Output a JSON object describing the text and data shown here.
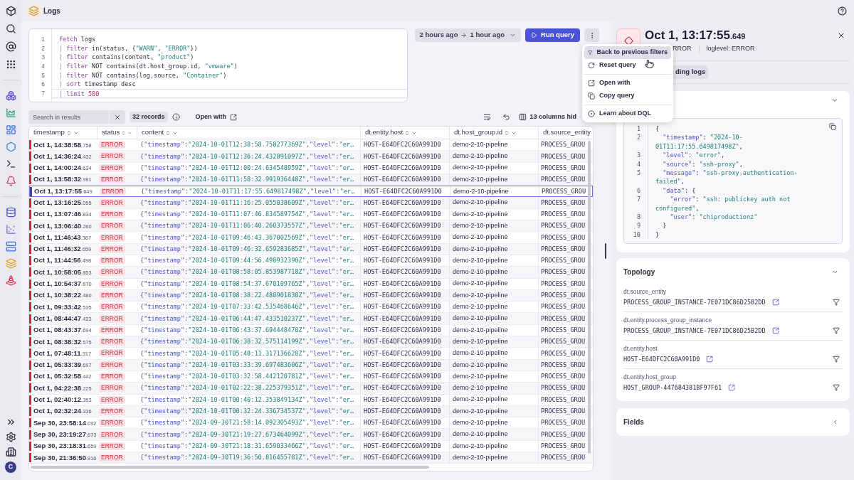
{
  "sidebar": {
    "avatar": "C"
  },
  "header": {
    "title": "Logs"
  },
  "editor": {
    "lines": [
      {
        "n": "1",
        "current": false,
        "segs": [
          {
            "text": "fetch",
            "kind": "kw"
          },
          {
            "text": " logs",
            "kind": "plain"
          }
        ]
      },
      {
        "n": "2",
        "current": false,
        "segs": [
          {
            "text": "| ",
            "kind": "pipe"
          },
          {
            "text": "filter",
            "kind": "kw"
          },
          {
            "text": " in(status, {",
            "kind": "plain"
          },
          {
            "text": "\"WARN\"",
            "kind": "str"
          },
          {
            "text": ", ",
            "kind": "plain"
          },
          {
            "text": "\"ERROR\"",
            "kind": "str"
          },
          {
            "text": "})",
            "kind": "plain"
          }
        ]
      },
      {
        "n": "3",
        "current": false,
        "segs": [
          {
            "text": "| ",
            "kind": "pipe"
          },
          {
            "text": "filter",
            "kind": "kw"
          },
          {
            "text": " contains(content, ",
            "kind": "plain"
          },
          {
            "text": "\"product\"",
            "kind": "str"
          },
          {
            "text": ")",
            "kind": "plain"
          }
        ]
      },
      {
        "n": "4",
        "current": false,
        "segs": [
          {
            "text": "| ",
            "kind": "pipe"
          },
          {
            "text": "filter",
            "kind": "kw"
          },
          {
            "text": " NOT contains(dt.host_group.id, ",
            "kind": "plain"
          },
          {
            "text": "\"vmware\"",
            "kind": "str"
          },
          {
            "text": ")",
            "kind": "plain"
          }
        ]
      },
      {
        "n": "5",
        "current": false,
        "segs": [
          {
            "text": "| ",
            "kind": "pipe"
          },
          {
            "text": "filter",
            "kind": "kw"
          },
          {
            "text": " NOT contains(log.source, ",
            "kind": "plain"
          },
          {
            "text": "\"Container\"",
            "kind": "str"
          },
          {
            "text": ")",
            "kind": "plain"
          }
        ]
      },
      {
        "n": "6",
        "current": false,
        "segs": [
          {
            "text": "| ",
            "kind": "pipe"
          },
          {
            "text": "sort",
            "kind": "kw"
          },
          {
            "text": " timestamp desc",
            "kind": "plain"
          }
        ]
      },
      {
        "n": "7",
        "current": true,
        "segs": [
          {
            "text": "| ",
            "kind": "pipe"
          },
          {
            "text": "limit",
            "kind": "kw"
          },
          {
            "text": " 500",
            "kind": "num"
          }
        ]
      }
    ]
  },
  "timeframe": {
    "from": "2 hours ago",
    "to": "1 hour ago"
  },
  "run_button": "Run query",
  "menu": {
    "groups": [
      [
        {
          "label": "Back to previous filters",
          "highlighted": true
        },
        {
          "label": "Reset query",
          "highlighted": false
        }
      ],
      [
        {
          "label": "Open with",
          "highlighted": false
        },
        {
          "label": "Copy query",
          "highlighted": false
        }
      ],
      [
        {
          "label": "Learn about DQL",
          "highlighted": false
        }
      ]
    ]
  },
  "results_toolbar": {
    "search_placeholder": "Search in results",
    "records": "32 records",
    "open_with": "Open with",
    "columns_hidden": "13 columns hid"
  },
  "table": {
    "columns": [
      "timestamp",
      "status",
      "content",
      "dt.entity.host",
      "dt.host_group.id",
      "dt.source_entity"
    ],
    "rows": [
      {
        "ts": "Oct 1, 14:38:58",
        "ms": ".758",
        "status": "ERROR",
        "content": "{\"timestamp\":\"2024-10-01T12:38:58.758277369Z\",\"level\":\"er…",
        "host": "HOST-E64DFC2C60A991D0",
        "group": "demo-2-10-pipeline",
        "source": "PROCESS_GROU",
        "selected": false
      },
      {
        "ts": "Oct 1, 14:36:24",
        "ms": ".432",
        "status": "ERROR",
        "content": "{\"timestamp\":\"2024-10-01T12:36:24.432891097Z\",\"level\":\"er…",
        "host": "HOST-E64DFC2C60A991D0",
        "group": "demo-2-10-pipeline",
        "source": "PROCESS_GROU",
        "selected": false
      },
      {
        "ts": "Oct 1, 14:00:24",
        "ms": ".634",
        "status": "ERROR",
        "content": "{\"timestamp\":\"2024-10-01T12:00:24.634548959Z\",\"level\":\"er…",
        "host": "HOST-E64DFC2C60A991D0",
        "group": "demo-2-10-pipeline",
        "source": "PROCESS_GROU",
        "selected": false
      },
      {
        "ts": "Oct 1, 13:58:32",
        "ms": ".991",
        "status": "ERROR",
        "content": "{\"timestamp\":\"2024-10-01T11:58:32.991936448Z\",\"level\":\"er…",
        "host": "HOST-E64DFC2C60A991D0",
        "group": "demo-2-10-pipeline",
        "source": "PROCESS_GROU",
        "selected": false
      },
      {
        "ts": "Oct 1, 13:17:55",
        "ms": ".649",
        "status": "ERROR",
        "content": "{\"timestamp\":\"2024-10-01T11:17:55.649817498Z\",\"level\":\"er…",
        "host": "HOST-E64DFC2C60A991D0",
        "group": "demo-2-10-pipeline",
        "source": "PROCESS_GROU",
        "selected": true
      },
      {
        "ts": "Oct 1, 13:16:25",
        "ms": ".055",
        "status": "ERROR",
        "content": "{\"timestamp\":\"2024-10-01T11:16:25.055038609Z\",\"level\":\"er…",
        "host": "HOST-E64DFC2C60A991D0",
        "group": "demo-2-10-pipeline",
        "source": "PROCESS_GROU",
        "selected": false
      },
      {
        "ts": "Oct 1, 13:07:46",
        "ms": ".834",
        "status": "ERROR",
        "content": "{\"timestamp\":\"2024-10-01T11:07:46.834589754Z\",\"level\":\"er…",
        "host": "HOST-E64DFC2C60A991D0",
        "group": "demo-2-10-pipeline",
        "source": "PROCESS_GROU",
        "selected": false
      },
      {
        "ts": "Oct 1, 13:06:40",
        "ms": ".260",
        "status": "ERROR",
        "content": "{\"timestamp\":\"2024-10-01T11:06:40.260373557Z\",\"level\":\"er…",
        "host": "HOST-E64DFC2C60A991D0",
        "group": "demo-2-10-pipeline",
        "source": "PROCESS_GROU",
        "selected": false
      },
      {
        "ts": "Oct 1, 11:46:43",
        "ms": ".367",
        "status": "ERROR",
        "content": "{\"timestamp\":\"2024-10-01T09:46:43.367002569Z\",\"level\":\"er…",
        "host": "HOST-E64DFC2C60A991D0",
        "group": "demo-2-10-pipeline",
        "source": "PROCESS_GROU",
        "selected": false
      },
      {
        "ts": "Oct 1, 11:46:32",
        "ms": ".659",
        "status": "ERROR",
        "content": "{\"timestamp\":\"2024-10-01T09:46:32.659283685Z\",\"level\":\"er…",
        "host": "HOST-E64DFC2C60A991D0",
        "group": "demo-2-10-pipeline",
        "source": "PROCESS_GROU",
        "selected": false
      },
      {
        "ts": "Oct 1, 11:44:56",
        "ms": ".498",
        "status": "ERROR",
        "content": "{\"timestamp\":\"2024-10-01T09:44:56.498932390Z\",\"level\":\"er…",
        "host": "HOST-E64DFC2C60A991D0",
        "group": "demo-2-10-pipeline",
        "source": "PROCESS_GROU",
        "selected": false
      },
      {
        "ts": "Oct 1, 10:58:05",
        "ms": ".853",
        "status": "ERROR",
        "content": "{\"timestamp\":\"2024-10-01T08:58:05.853987718Z\",\"level\":\"er…",
        "host": "HOST-E64DFC2C60A991D0",
        "group": "demo-2-10-pipeline",
        "source": "PROCESS_GROU",
        "selected": false
      },
      {
        "ts": "Oct 1, 10:54:37",
        "ms": ".670",
        "status": "ERROR",
        "content": "{\"timestamp\":\"2024-10-01T08:54:37.670109765Z\",\"level\":\"er…",
        "host": "HOST-E64DFC2C60A991D0",
        "group": "demo-2-10-pipeline",
        "source": "PROCESS_GROU",
        "selected": false
      },
      {
        "ts": "Oct 1, 10:38:22",
        "ms": ".480",
        "status": "ERROR",
        "content": "{\"timestamp\":\"2024-10-01T08:38:22.480901830Z\",\"level\":\"er…",
        "host": "HOST-E64DFC2C60A991D0",
        "group": "demo-2-10-pipeline",
        "source": "PROCESS_GROU",
        "selected": false
      },
      {
        "ts": "Oct 1, 09:33:42",
        "ms": ".535",
        "status": "ERROR",
        "content": "{\"timestamp\":\"2024-10-01T07:33:42.535468646Z\",\"level\":\"er…",
        "host": "HOST-E64DFC2C60A991D0",
        "group": "demo-2-10-pipeline",
        "source": "PROCESS_GROU",
        "selected": false
      },
      {
        "ts": "Oct 1, 08:44:47",
        "ms": ".433",
        "status": "ERROR",
        "content": "{\"timestamp\":\"2024-10-01T06:44:47.433510237Z\",\"level\":\"er…",
        "host": "HOST-E64DFC2C60A991D0",
        "group": "demo-2-10-pipeline",
        "source": "PROCESS_GROU",
        "selected": false
      },
      {
        "ts": "Oct 1, 08:43:37",
        "ms": ".694",
        "status": "ERROR",
        "content": "{\"timestamp\":\"2024-10-01T06:43:37.694448470Z\",\"level\":\"er…",
        "host": "HOST-E64DFC2C60A991D0",
        "group": "demo-2-10-pipeline",
        "source": "PROCESS_GROU",
        "selected": false
      },
      {
        "ts": "Oct 1, 08:38:32",
        "ms": ".575",
        "status": "ERROR",
        "content": "{\"timestamp\":\"2024-10-01T06:38:32.575114199Z\",\"level\":\"er…",
        "host": "HOST-E64DFC2C60A991D0",
        "group": "demo-2-10-pipeline",
        "source": "PROCESS_GROU",
        "selected": false
      },
      {
        "ts": "Oct 1, 07:48:11",
        "ms": ".317",
        "status": "ERROR",
        "content": "{\"timestamp\":\"2024-10-01T05:48:11.317136628Z\",\"level\":\"er…",
        "host": "HOST-E64DFC2C60A991D0",
        "group": "demo-2-10-pipeline",
        "source": "PROCESS_GROU",
        "selected": false
      },
      {
        "ts": "Oct 1, 05:33:39",
        "ms": ".697",
        "status": "ERROR",
        "content": "{\"timestamp\":\"2024-10-01T03:33:39.697483606Z\",\"level\":\"er…",
        "host": "HOST-E64DFC2C60A991D0",
        "group": "demo-2-10-pipeline",
        "source": "PROCESS_GROU",
        "selected": false
      },
      {
        "ts": "Oct 1, 05:32:58",
        "ms": ".442",
        "status": "ERROR",
        "content": "{\"timestamp\":\"2024-10-01T03:32:58.442120781Z\",\"level\":\"er…",
        "host": "HOST-E64DFC2C60A991D0",
        "group": "demo-2-10-pipeline",
        "source": "PROCESS_GROU",
        "selected": false
      },
      {
        "ts": "Oct 1, 04:22:38",
        "ms": ".225",
        "status": "ERROR",
        "content": "{\"timestamp\":\"2024-10-01T02:22:38.225379351Z\",\"level\":\"er…",
        "host": "HOST-E64DFC2C60A991D0",
        "group": "demo-2-10-pipeline",
        "source": "PROCESS_GROU",
        "selected": false
      },
      {
        "ts": "Oct 1, 02:40:12",
        "ms": ".353",
        "status": "ERROR",
        "content": "{\"timestamp\":\"2024-10-01T00:40:12.353849134Z\",\"level\":\"er…",
        "host": "HOST-E64DFC2C60A991D0",
        "group": "demo-2-10-pipeline",
        "source": "PROCESS_GROU",
        "selected": false
      },
      {
        "ts": "Oct 1, 02:32:24",
        "ms": ".336",
        "status": "ERROR",
        "content": "{\"timestamp\":\"2024-10-01T00:32:24.336734537Z\",\"level\":\"er…",
        "host": "HOST-E64DFC2C60A991D0",
        "group": "demo-2-10-pipeline",
        "source": "PROCESS_GROU",
        "selected": false
      },
      {
        "ts": "Sep 30, 23:58:14",
        "ms": ".092",
        "status": "ERROR",
        "content": "{\"timestamp\":\"2024-09-30T21:58:14.092305493Z\",\"level\":\"er…",
        "host": "HOST-E64DFC2C60A991D0",
        "group": "demo-2-10-pipeline",
        "source": "PROCESS_GROU",
        "selected": false
      },
      {
        "ts": "Sep 30, 23:19:27",
        "ms": ".673",
        "status": "ERROR",
        "content": "{\"timestamp\":\"2024-09-30T21:19:27.673464099Z\",\"level\":\"er…",
        "host": "HOST-E64DFC2C60A991D0",
        "group": "demo-2-10-pipeline",
        "source": "PROCESS_GROU",
        "selected": false
      },
      {
        "ts": "Sep 30, 23:18:31",
        "ms": ".659",
        "status": "ERROR",
        "content": "{\"timestamp\":\"2024-09-30T21:18:31.659033466Z\",\"level\":\"er…",
        "host": "HOST-E64DFC2C60A991D0",
        "group": "demo-2-10-pipeline",
        "source": "PROCESS_GROU",
        "selected": false
      },
      {
        "ts": "Sep 30, 21:36:50",
        "ms": ".816",
        "status": "ERROR",
        "content": "{\"timestamp\":\"2024-09-30T19:36:50.816455781Z\",\"level\":\"er…",
        "host": "HOST-E64DFC2C60A991D0",
        "group": "demo-2-10-pipeline",
        "source": "PROCESS_GROU",
        "selected": false
      }
    ]
  },
  "detail": {
    "title": "Oct 1, 13:17:55",
    "title_ms": ".649",
    "status": "RROR",
    "loglevel": "loglevel: ERROR",
    "surrounding_button": "ding logs",
    "expanded": true,
    "code_lines": [
      {
        "n": "1",
        "segs": [
          {
            "text": "{",
            "kind": "plain"
          }
        ]
      },
      {
        "n": "2",
        "segs": [
          {
            "text": "  \"timestamp\"",
            "kind": "key"
          },
          {
            "text": ": ",
            "kind": "plain"
          },
          {
            "text": "\"2024-10-",
            "kind": "str"
          }
        ]
      },
      {
        "segs": [
          {
            "text": "01T11:17:55.649817498Z\"",
            "kind": "str"
          },
          {
            "text": ",",
            "kind": "plain"
          }
        ]
      },
      {
        "n": "3",
        "segs": [
          {
            "text": "  \"level\"",
            "kind": "key"
          },
          {
            "text": ": ",
            "kind": "plain"
          },
          {
            "text": "\"error\"",
            "kind": "str"
          },
          {
            "text": ",",
            "kind": "plain"
          }
        ]
      },
      {
        "n": "4",
        "segs": [
          {
            "text": "  \"source\"",
            "kind": "key"
          },
          {
            "text": ": ",
            "kind": "plain"
          },
          {
            "text": "\"ssh-proxy\"",
            "kind": "str"
          },
          {
            "text": ",",
            "kind": "plain"
          }
        ]
      },
      {
        "n": "5",
        "segs": [
          {
            "text": "  \"message\"",
            "kind": "key"
          },
          {
            "text": ": ",
            "kind": "plain"
          },
          {
            "text": "\"ssh-proxy.authentication-",
            "kind": "str"
          }
        ]
      },
      {
        "segs": [
          {
            "text": "failed\"",
            "kind": "str"
          },
          {
            "text": ",",
            "kind": "plain"
          }
        ]
      },
      {
        "n": "6",
        "segs": [
          {
            "text": "  \"data\"",
            "kind": "key"
          },
          {
            "text": ": {",
            "kind": "plain"
          }
        ]
      },
      {
        "n": "7",
        "segs": [
          {
            "text": "    \"error\"",
            "kind": "key"
          },
          {
            "text": ": ",
            "kind": "plain"
          },
          {
            "text": "\"ssh: publickey auth not",
            "kind": "str"
          }
        ]
      },
      {
        "segs": [
          {
            "text": "configured\"",
            "kind": "str"
          },
          {
            "text": ",",
            "kind": "plain"
          }
        ]
      },
      {
        "n": "8",
        "segs": [
          {
            "text": "    \"user\"",
            "kind": "key"
          },
          {
            "text": ": ",
            "kind": "plain"
          },
          {
            "text": "\"chiproductionz\"",
            "kind": "str"
          }
        ]
      },
      {
        "n": "9",
        "segs": [
          {
            "text": "  }",
            "kind": "plain"
          }
        ]
      },
      {
        "n": "10",
        "segs": [
          {
            "text": "}",
            "kind": "plain"
          }
        ]
      }
    ],
    "topology": {
      "title": "Topology",
      "expanded": true,
      "items": [
        {
          "label": "dt.source_entity",
          "value": "PROCESS_GROUP_INSTANCE-7E071DC86D25B2DD"
        },
        {
          "label": "dt.entity.process_group_instance",
          "value": "PROCESS_GROUP_INSTANCE-7E071DC86D25B2DD"
        },
        {
          "label": "dt.entity.host",
          "value": "HOST-E64DFC2C60A991D0"
        },
        {
          "label": "dt.entity.host_group",
          "value": "HOST_GROUP-447684381BF97F61"
        }
      ]
    },
    "fields": {
      "title": "Fields",
      "expanded": false
    }
  }
}
